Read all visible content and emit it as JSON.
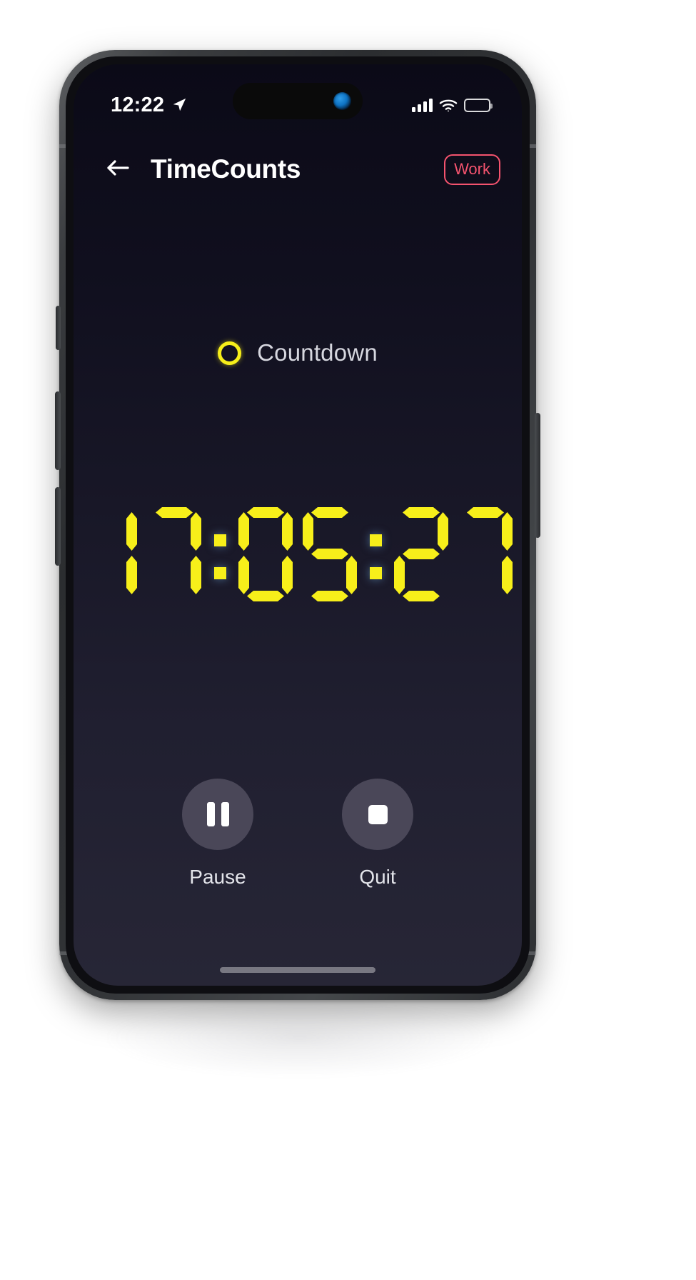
{
  "status_bar": {
    "time": "12:22",
    "location_icon": "location-arrow-icon",
    "signal_icon": "cellular-signal-icon",
    "wifi_icon": "wifi-icon",
    "battery_icon": "battery-full-icon"
  },
  "navbar": {
    "back_icon": "arrow-left-icon",
    "title": "TimeCounts",
    "badge_label": "Work",
    "badge_color": "#f4536e"
  },
  "mode": {
    "icon": "ring-circle-icon",
    "label": "Countdown",
    "accent_color": "#f7ef1a"
  },
  "timer": {
    "display": "17:05:27",
    "hours": "17",
    "minutes": "05",
    "seconds": "27",
    "segments": [
      "1",
      "7",
      ":",
      "0",
      "5",
      ":",
      "2",
      "7"
    ],
    "color": "#f7ef1a"
  },
  "controls": [
    {
      "name": "pause",
      "label": "Pause",
      "icon": "pause-icon"
    },
    {
      "name": "quit",
      "label": "Quit",
      "icon": "stop-square-icon"
    }
  ],
  "screen_background": "#141327"
}
